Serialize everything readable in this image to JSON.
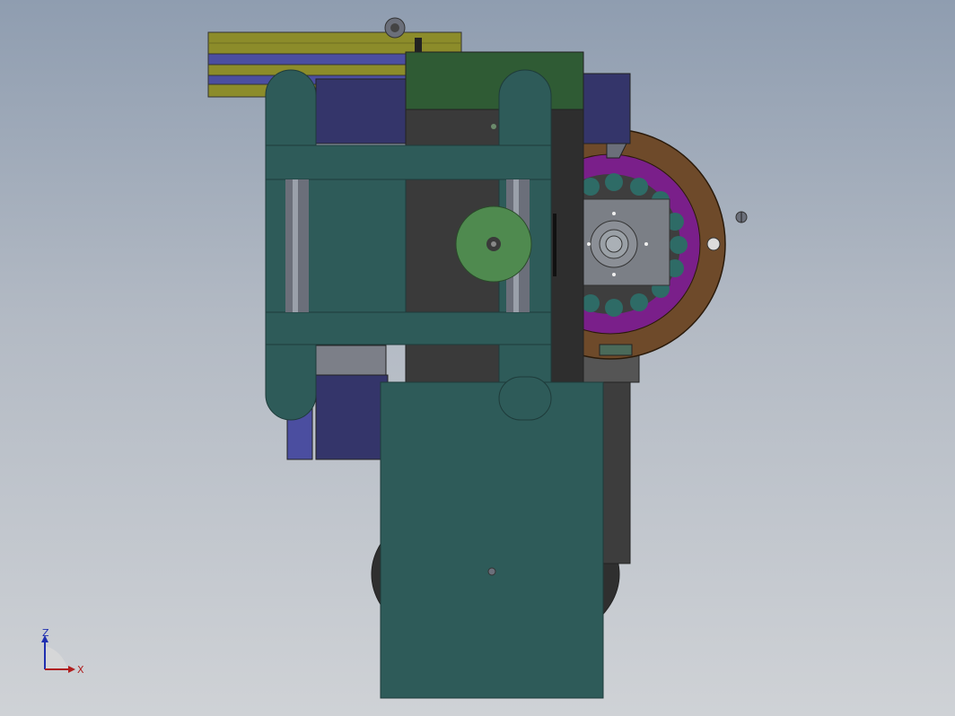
{
  "viewport": {
    "background_top": "#8f9db0",
    "background_bottom": "#cfd2d6"
  },
  "colors": {
    "teal_frame": "#2e5b59",
    "dark_steel": "#3a3a3a",
    "navy_motor": "#34356a",
    "olive_pulley": "#8c8c2a",
    "green_block": "#2f5b34",
    "purple_ring": "#7a1f8a",
    "bronze_disc": "#6e4a2a",
    "shaft_grey": "#6b6f7a",
    "light_green_hub": "#4f8a4f"
  },
  "triad": {
    "z_label": "Z",
    "x_label": "X",
    "z_color": "#1f2fb0",
    "x_color": "#b01f1f"
  }
}
